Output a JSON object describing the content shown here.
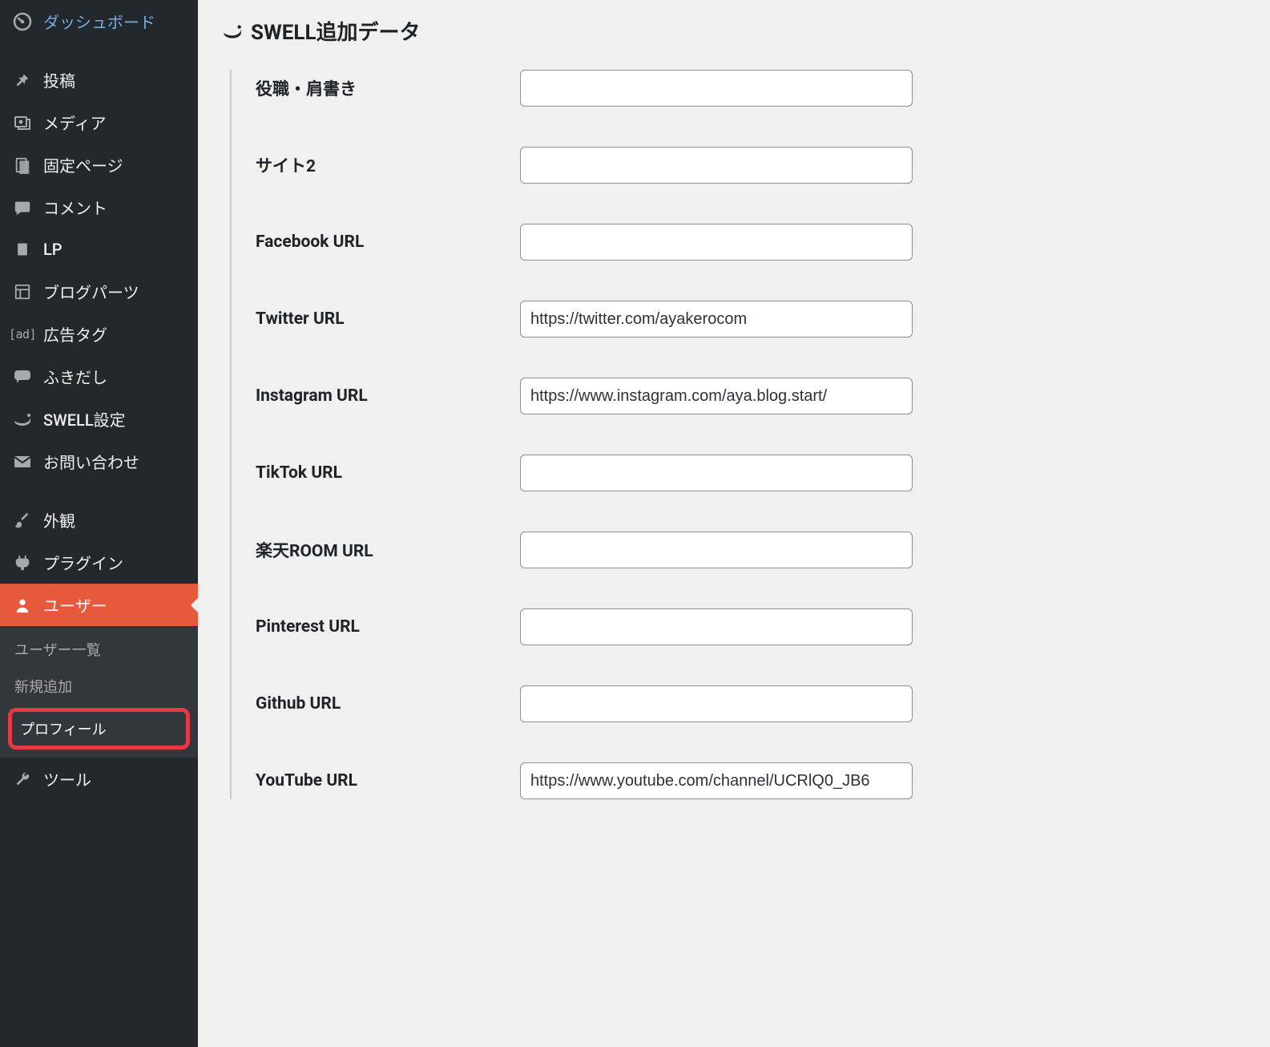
{
  "sidebar": {
    "items": [
      {
        "label": "ダッシュボード",
        "icon": "dashboard-icon"
      },
      {
        "label": "投稿",
        "icon": "pin-icon"
      },
      {
        "label": "メディア",
        "icon": "media-icon"
      },
      {
        "label": "固定ページ",
        "icon": "pages-icon"
      },
      {
        "label": "コメント",
        "icon": "comment-icon"
      },
      {
        "label": "LP",
        "icon": "doc-icon"
      },
      {
        "label": "ブログパーツ",
        "icon": "grid-icon"
      },
      {
        "label": "広告タグ",
        "icon": "ad-icon"
      },
      {
        "label": "ふきだし",
        "icon": "speech-icon"
      },
      {
        "label": "SWELL設定",
        "icon": "swell-icon"
      },
      {
        "label": "お問い合わせ",
        "icon": "mail-icon"
      },
      {
        "label": "外観",
        "icon": "brush-icon"
      },
      {
        "label": "プラグイン",
        "icon": "plug-icon"
      },
      {
        "label": "ユーザー",
        "icon": "user-icon"
      },
      {
        "label": "ツール",
        "icon": "wrench-icon"
      }
    ],
    "submenu_users": [
      {
        "label": "ユーザー一覧"
      },
      {
        "label": "新規追加"
      },
      {
        "label": "プロフィール"
      }
    ]
  },
  "section": {
    "title": "SWELL追加データ"
  },
  "fields": [
    {
      "label": "役職・肩書き",
      "value": ""
    },
    {
      "label": "サイト2",
      "value": ""
    },
    {
      "label": "Facebook URL",
      "value": ""
    },
    {
      "label": "Twitter URL",
      "value": "https://twitter.com/ayakerocom"
    },
    {
      "label": "Instagram URL",
      "value": "https://www.instagram.com/aya.blog.start/"
    },
    {
      "label": "TikTok URL",
      "value": ""
    },
    {
      "label": "楽天ROOM URL",
      "value": ""
    },
    {
      "label": "Pinterest URL",
      "value": ""
    },
    {
      "label": "Github URL",
      "value": ""
    },
    {
      "label": "YouTube URL",
      "value": "https://www.youtube.com/channel/UCRlQ0_JB6"
    }
  ]
}
